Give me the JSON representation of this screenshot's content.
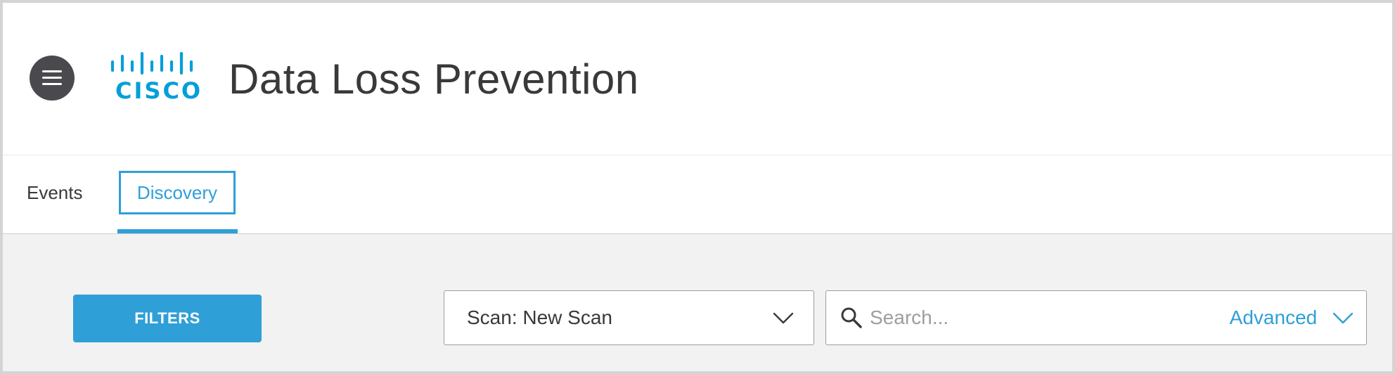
{
  "header": {
    "menu_icon": "hamburger-menu-icon",
    "logo_text": "CISCO",
    "title": "Data Loss Prevention"
  },
  "tabs": [
    {
      "label": "Events",
      "active": false
    },
    {
      "label": "Discovery",
      "active": true
    }
  ],
  "toolbar": {
    "filters_label": "FILTERS",
    "scan_select": {
      "value": "Scan: New Scan"
    },
    "search": {
      "placeholder": "Search...",
      "value": "",
      "advanced_label": "Advanced"
    }
  },
  "colors": {
    "accent": "#2f9fd8",
    "brand": "#049fd9",
    "text": "#39393b",
    "menu_button": "#4a4a4e",
    "toolbar_background": "#f2f2f2"
  }
}
